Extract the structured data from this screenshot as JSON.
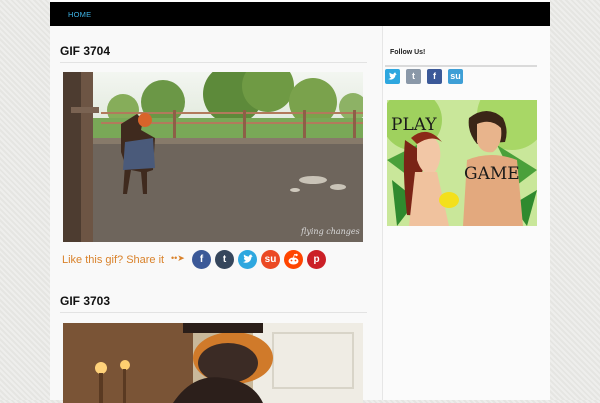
{
  "nav": {
    "home": "HOME"
  },
  "posts": [
    {
      "title": "GIF 3704",
      "watermark": "flying changes"
    },
    {
      "title": "GIF 3703"
    }
  ],
  "share": {
    "text": "Like this gif? Share it",
    "arrow": "••➤"
  },
  "share_icons": [
    "facebook-icon",
    "tumblr-icon",
    "twitter-icon",
    "stumbleupon-icon",
    "reddit-icon",
    "pinterest-icon"
  ],
  "sidebar": {
    "follow_title": "Follow Us!",
    "follow_icons": [
      "twitter-icon",
      "tumblr-icon",
      "facebook-icon",
      "stumbleupon-icon"
    ]
  },
  "ad": {
    "line1": "PLAY",
    "line2": "GAME"
  },
  "colors": {
    "nav_bg": "#000000",
    "nav_link": "#3fb5e8",
    "share_text": "#d9822b",
    "facebook": "#3b5998",
    "tumblr": "#35465c",
    "twitter": "#2ea7df",
    "stumbleupon": "#eb4924",
    "reddit": "#ff4500",
    "pinterest": "#cb2027"
  }
}
